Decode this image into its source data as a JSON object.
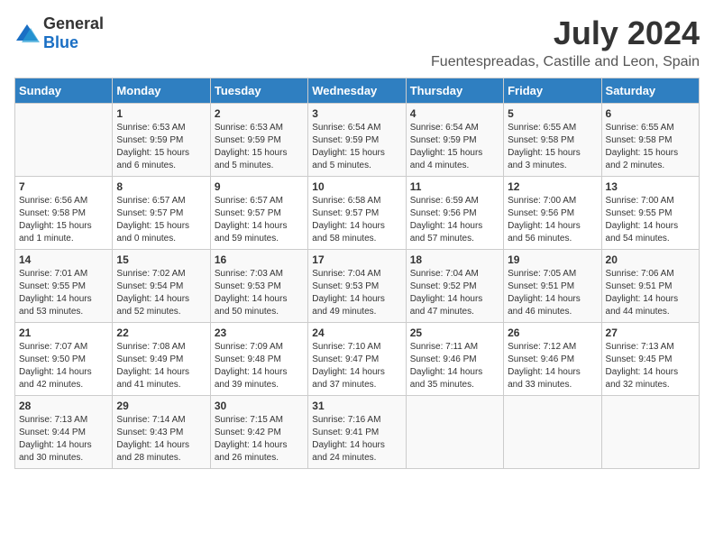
{
  "logo": {
    "general": "General",
    "blue": "Blue"
  },
  "title": "July 2024",
  "subtitle": "Fuentespreadas, Castille and Leon, Spain",
  "headers": [
    "Sunday",
    "Monday",
    "Tuesday",
    "Wednesday",
    "Thursday",
    "Friday",
    "Saturday"
  ],
  "weeks": [
    [
      {
        "day": "",
        "sunrise": "",
        "sunset": "",
        "daylight": ""
      },
      {
        "day": "1",
        "sunrise": "Sunrise: 6:53 AM",
        "sunset": "Sunset: 9:59 PM",
        "daylight": "Daylight: 15 hours and 6 minutes."
      },
      {
        "day": "2",
        "sunrise": "Sunrise: 6:53 AM",
        "sunset": "Sunset: 9:59 PM",
        "daylight": "Daylight: 15 hours and 5 minutes."
      },
      {
        "day": "3",
        "sunrise": "Sunrise: 6:54 AM",
        "sunset": "Sunset: 9:59 PM",
        "daylight": "Daylight: 15 hours and 5 minutes."
      },
      {
        "day": "4",
        "sunrise": "Sunrise: 6:54 AM",
        "sunset": "Sunset: 9:59 PM",
        "daylight": "Daylight: 15 hours and 4 minutes."
      },
      {
        "day": "5",
        "sunrise": "Sunrise: 6:55 AM",
        "sunset": "Sunset: 9:58 PM",
        "daylight": "Daylight: 15 hours and 3 minutes."
      },
      {
        "day": "6",
        "sunrise": "Sunrise: 6:55 AM",
        "sunset": "Sunset: 9:58 PM",
        "daylight": "Daylight: 15 hours and 2 minutes."
      }
    ],
    [
      {
        "day": "7",
        "sunrise": "Sunrise: 6:56 AM",
        "sunset": "Sunset: 9:58 PM",
        "daylight": "Daylight: 15 hours and 1 minute."
      },
      {
        "day": "8",
        "sunrise": "Sunrise: 6:57 AM",
        "sunset": "Sunset: 9:57 PM",
        "daylight": "Daylight: 15 hours and 0 minutes."
      },
      {
        "day": "9",
        "sunrise": "Sunrise: 6:57 AM",
        "sunset": "Sunset: 9:57 PM",
        "daylight": "Daylight: 14 hours and 59 minutes."
      },
      {
        "day": "10",
        "sunrise": "Sunrise: 6:58 AM",
        "sunset": "Sunset: 9:57 PM",
        "daylight": "Daylight: 14 hours and 58 minutes."
      },
      {
        "day": "11",
        "sunrise": "Sunrise: 6:59 AM",
        "sunset": "Sunset: 9:56 PM",
        "daylight": "Daylight: 14 hours and 57 minutes."
      },
      {
        "day": "12",
        "sunrise": "Sunrise: 7:00 AM",
        "sunset": "Sunset: 9:56 PM",
        "daylight": "Daylight: 14 hours and 56 minutes."
      },
      {
        "day": "13",
        "sunrise": "Sunrise: 7:00 AM",
        "sunset": "Sunset: 9:55 PM",
        "daylight": "Daylight: 14 hours and 54 minutes."
      }
    ],
    [
      {
        "day": "14",
        "sunrise": "Sunrise: 7:01 AM",
        "sunset": "Sunset: 9:55 PM",
        "daylight": "Daylight: 14 hours and 53 minutes."
      },
      {
        "day": "15",
        "sunrise": "Sunrise: 7:02 AM",
        "sunset": "Sunset: 9:54 PM",
        "daylight": "Daylight: 14 hours and 52 minutes."
      },
      {
        "day": "16",
        "sunrise": "Sunrise: 7:03 AM",
        "sunset": "Sunset: 9:53 PM",
        "daylight": "Daylight: 14 hours and 50 minutes."
      },
      {
        "day": "17",
        "sunrise": "Sunrise: 7:04 AM",
        "sunset": "Sunset: 9:53 PM",
        "daylight": "Daylight: 14 hours and 49 minutes."
      },
      {
        "day": "18",
        "sunrise": "Sunrise: 7:04 AM",
        "sunset": "Sunset: 9:52 PM",
        "daylight": "Daylight: 14 hours and 47 minutes."
      },
      {
        "day": "19",
        "sunrise": "Sunrise: 7:05 AM",
        "sunset": "Sunset: 9:51 PM",
        "daylight": "Daylight: 14 hours and 46 minutes."
      },
      {
        "day": "20",
        "sunrise": "Sunrise: 7:06 AM",
        "sunset": "Sunset: 9:51 PM",
        "daylight": "Daylight: 14 hours and 44 minutes."
      }
    ],
    [
      {
        "day": "21",
        "sunrise": "Sunrise: 7:07 AM",
        "sunset": "Sunset: 9:50 PM",
        "daylight": "Daylight: 14 hours and 42 minutes."
      },
      {
        "day": "22",
        "sunrise": "Sunrise: 7:08 AM",
        "sunset": "Sunset: 9:49 PM",
        "daylight": "Daylight: 14 hours and 41 minutes."
      },
      {
        "day": "23",
        "sunrise": "Sunrise: 7:09 AM",
        "sunset": "Sunset: 9:48 PM",
        "daylight": "Daylight: 14 hours and 39 minutes."
      },
      {
        "day": "24",
        "sunrise": "Sunrise: 7:10 AM",
        "sunset": "Sunset: 9:47 PM",
        "daylight": "Daylight: 14 hours and 37 minutes."
      },
      {
        "day": "25",
        "sunrise": "Sunrise: 7:11 AM",
        "sunset": "Sunset: 9:46 PM",
        "daylight": "Daylight: 14 hours and 35 minutes."
      },
      {
        "day": "26",
        "sunrise": "Sunrise: 7:12 AM",
        "sunset": "Sunset: 9:46 PM",
        "daylight": "Daylight: 14 hours and 33 minutes."
      },
      {
        "day": "27",
        "sunrise": "Sunrise: 7:13 AM",
        "sunset": "Sunset: 9:45 PM",
        "daylight": "Daylight: 14 hours and 32 minutes."
      }
    ],
    [
      {
        "day": "28",
        "sunrise": "Sunrise: 7:13 AM",
        "sunset": "Sunset: 9:44 PM",
        "daylight": "Daylight: 14 hours and 30 minutes."
      },
      {
        "day": "29",
        "sunrise": "Sunrise: 7:14 AM",
        "sunset": "Sunset: 9:43 PM",
        "daylight": "Daylight: 14 hours and 28 minutes."
      },
      {
        "day": "30",
        "sunrise": "Sunrise: 7:15 AM",
        "sunset": "Sunset: 9:42 PM",
        "daylight": "Daylight: 14 hours and 26 minutes."
      },
      {
        "day": "31",
        "sunrise": "Sunrise: 7:16 AM",
        "sunset": "Sunset: 9:41 PM",
        "daylight": "Daylight: 14 hours and 24 minutes."
      },
      {
        "day": "",
        "sunrise": "",
        "sunset": "",
        "daylight": ""
      },
      {
        "day": "",
        "sunrise": "",
        "sunset": "",
        "daylight": ""
      },
      {
        "day": "",
        "sunrise": "",
        "sunset": "",
        "daylight": ""
      }
    ]
  ]
}
